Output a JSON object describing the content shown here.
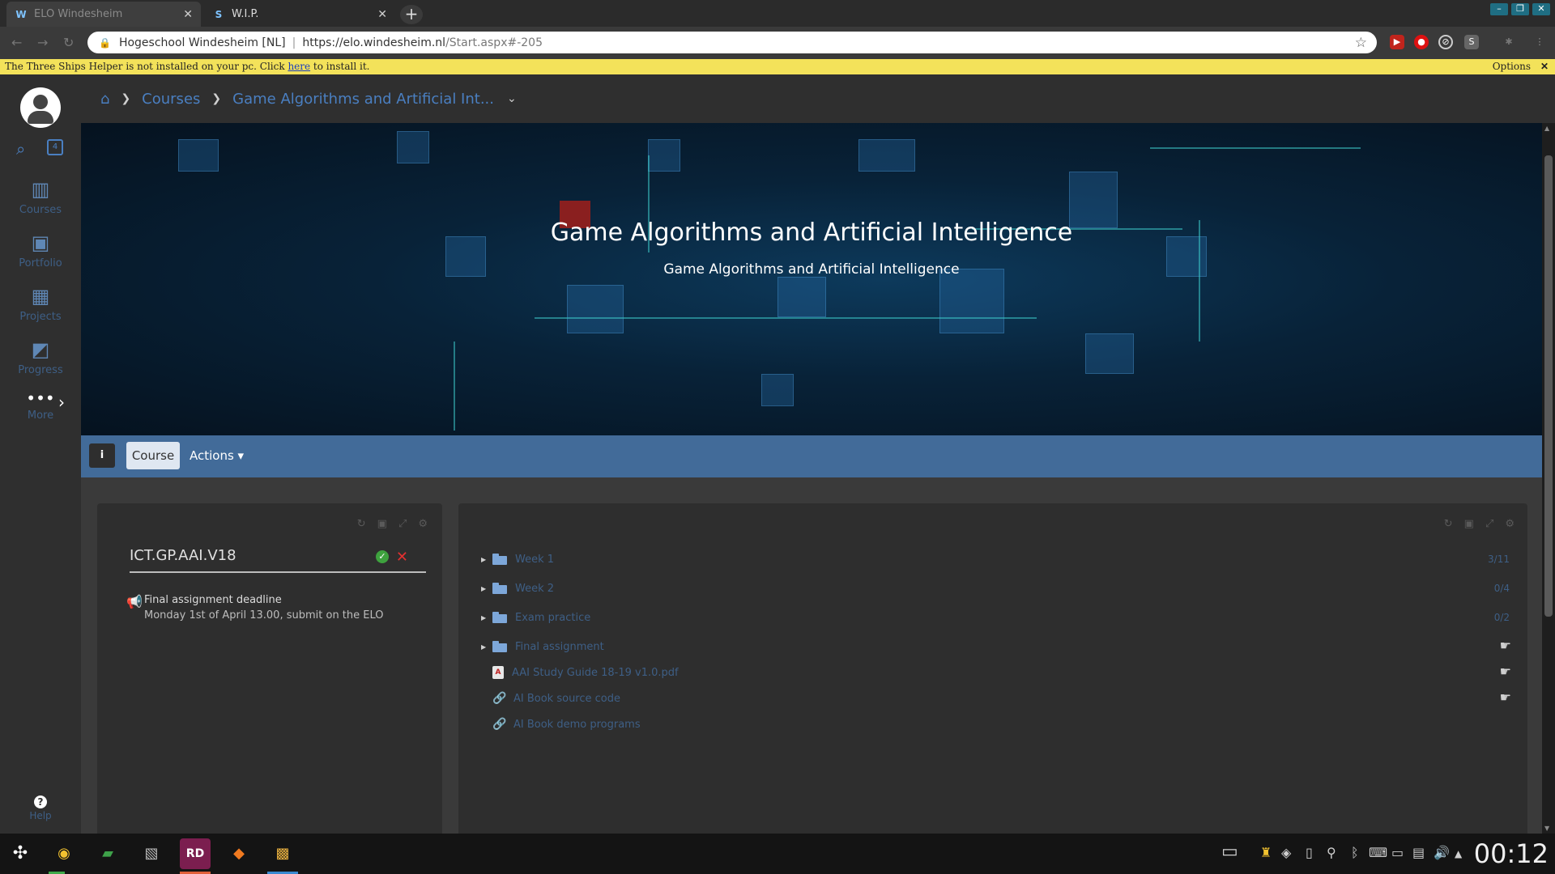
{
  "browser": {
    "tabs": [
      {
        "title": "ELO Windesheim",
        "active": true
      },
      {
        "title": "W.I.P.",
        "active": false
      }
    ],
    "omnibox": {
      "site_identity": "Hogeschool Windesheim [NL]",
      "url_host": "https://elo.windesheim.nl",
      "url_path": "/Start.aspx#-205"
    },
    "infobar": {
      "text_before": "The Three Ships Helper is not installed on your pc. Click ",
      "link": "here",
      "text_after": " to install it.",
      "options": "Options"
    }
  },
  "sidebar": {
    "items": [
      {
        "label": "Courses",
        "icon": "books-icon"
      },
      {
        "label": "Portfolio",
        "icon": "briefcase-icon"
      },
      {
        "label": "Projects",
        "icon": "projects-icon"
      },
      {
        "label": "Progress",
        "icon": "chart-icon"
      },
      {
        "label": "More",
        "icon": "more-icon"
      }
    ],
    "help_label": "Help"
  },
  "breadcrumb": {
    "courses": "Courses",
    "current": "Game Algorithms and Artificial Int..."
  },
  "banner": {
    "title": "Game Algorithms and Artificial Intelligence",
    "subtitle": "Game Algorithms and Artificial Intelligence"
  },
  "course_toolbar": {
    "info": "i",
    "course": "Course",
    "actions": "Actions ▾"
  },
  "left_panel": {
    "course_code": "ICT.GP.AAI.V18",
    "announcement_title": "Final assignment deadline",
    "announcement_text": "Monday 1st of April 13.00, submit on the ELO"
  },
  "right_panel": {
    "items": [
      {
        "type": "folder",
        "label": "Week 1",
        "count": "3/11"
      },
      {
        "type": "folder",
        "label": "Week 2",
        "count": "0/4"
      },
      {
        "type": "folder",
        "label": "Exam practice",
        "count": "0/2"
      },
      {
        "type": "folder",
        "label": "Final assignment",
        "count": ""
      },
      {
        "type": "pdf",
        "label": "AAI Study Guide 18-19 v1.0.pdf",
        "count": ""
      },
      {
        "type": "link",
        "label": "AI Book source code",
        "count": ""
      },
      {
        "type": "link",
        "label": "AI Book demo programs",
        "count": ""
      }
    ]
  },
  "taskbar": {
    "clock": "00:12"
  },
  "colors": {
    "accent": "#426b99",
    "link": "#3e5f86",
    "sidebar_bg": "#2f2f2f"
  }
}
